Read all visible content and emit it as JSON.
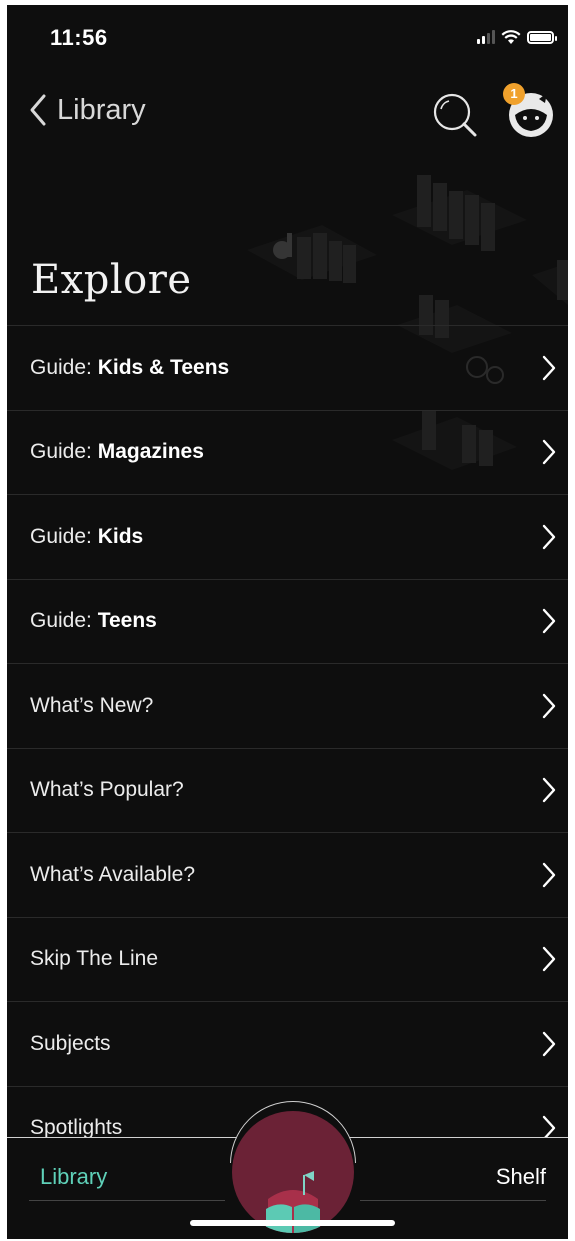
{
  "status_bar": {
    "time": "11:56"
  },
  "nav": {
    "back_label": "Library",
    "badge_count": "1"
  },
  "page": {
    "title": "Explore"
  },
  "menu": [
    {
      "prefix": "Guide: ",
      "bold": "Kids & Teens"
    },
    {
      "prefix": "Guide: ",
      "bold": "Magazines"
    },
    {
      "prefix": "Guide: ",
      "bold": "Kids"
    },
    {
      "prefix": "Guide: ",
      "bold": "Teens"
    },
    {
      "prefix": "What’s New?",
      "bold": ""
    },
    {
      "prefix": "What’s Popular?",
      "bold": ""
    },
    {
      "prefix": "What’s Available?",
      "bold": ""
    },
    {
      "prefix": "Skip The Line",
      "bold": ""
    },
    {
      "prefix": "Subjects",
      "bold": ""
    },
    {
      "prefix": "Spotlights",
      "bold": ""
    }
  ],
  "tab_bar": {
    "left_label": "Library",
    "right_label": "Shelf"
  },
  "colors": {
    "background": "#0e0e0e",
    "accent_teal": "#5fd1b9",
    "badge_orange": "#f0a12c",
    "center_button": "#6b2236"
  },
  "icons": {
    "back": "chevron-left-icon",
    "search": "search-icon",
    "profile": "profile-icon",
    "row_chevron": "chevron-right-icon",
    "center": "open-book-icon"
  }
}
